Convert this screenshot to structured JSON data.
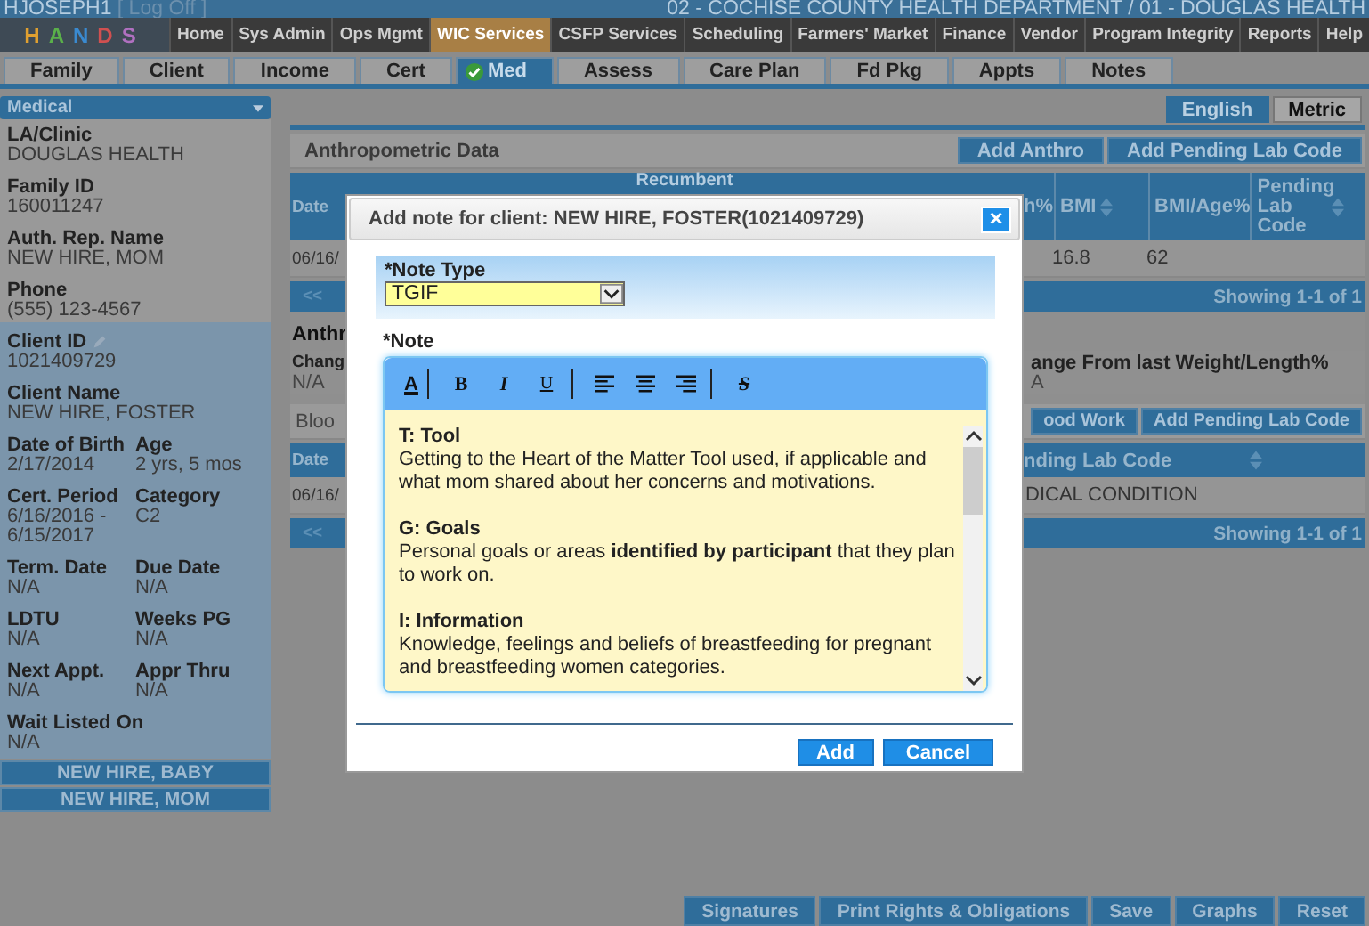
{
  "header": {
    "user": "HJOSEPH1",
    "logoff": "[ Log Off ]",
    "location": "02 - COCHISE COUNTY HEALTH DEPARTMENT / 01 - DOUGLAS HEALTH"
  },
  "logo": "HANDS",
  "menu": [
    {
      "label": "Home",
      "selected": false
    },
    {
      "label": "Sys Admin",
      "selected": false
    },
    {
      "label": "Ops Mgmt",
      "selected": false
    },
    {
      "label": "WIC Services",
      "selected": true
    },
    {
      "label": "CSFP Services",
      "selected": false
    },
    {
      "label": "Scheduling",
      "selected": false
    },
    {
      "label": "Farmers' Market",
      "selected": false
    },
    {
      "label": "Finance",
      "selected": false
    },
    {
      "label": "Vendor",
      "selected": false
    },
    {
      "label": "Program Integrity",
      "selected": false
    },
    {
      "label": "Reports",
      "selected": false
    },
    {
      "label": "Help",
      "selected": false
    }
  ],
  "tabs": [
    {
      "label": "Family",
      "selected": false,
      "checked": false
    },
    {
      "label": "Client",
      "selected": false,
      "checked": false
    },
    {
      "label": "Income",
      "selected": false,
      "checked": false
    },
    {
      "label": "Cert",
      "selected": false,
      "checked": false
    },
    {
      "label": "Med",
      "selected": true,
      "checked": true
    },
    {
      "label": "Assess",
      "selected": false,
      "checked": false
    },
    {
      "label": "Care Plan",
      "selected": false,
      "checked": false
    },
    {
      "label": "Fd Pkg",
      "selected": false,
      "checked": false
    },
    {
      "label": "Appts",
      "selected": false,
      "checked": false
    },
    {
      "label": "Notes",
      "selected": false,
      "checked": false
    }
  ],
  "sidebar": {
    "title": "Medical",
    "family_fields": [
      {
        "label": "LA/Clinic",
        "value": "DOUGLAS HEALTH"
      },
      {
        "label": "Family ID",
        "value": "160011247"
      },
      {
        "label": "Auth. Rep. Name",
        "value": "NEW HIRE, MOM"
      },
      {
        "label": "Phone",
        "value": "(555) 123-4567"
      }
    ],
    "client_fields": [
      {
        "kind": "full",
        "label": "Client ID",
        "value": "1021409729",
        "editable": true
      },
      {
        "kind": "full",
        "label": "Client Name",
        "value": "NEW HIRE, FOSTER",
        "editable": false
      },
      {
        "kind": "half",
        "label": "Date of Birth",
        "value": "2/17/2014",
        "editable": false
      },
      {
        "kind": "half",
        "label": "Age",
        "value": "2 yrs, 5 mos",
        "editable": false
      },
      {
        "kind": "half",
        "label": "Cert. Period",
        "value": "6/16/2016 - 6/15/2017",
        "editable": false
      },
      {
        "kind": "half",
        "label": "Category",
        "value": "C2",
        "editable": false
      },
      {
        "kind": "half",
        "label": "Term. Date",
        "value": "N/A",
        "editable": false
      },
      {
        "kind": "half",
        "label": "Due Date",
        "value": "N/A",
        "editable": false
      },
      {
        "kind": "half",
        "label": "LDTU",
        "value": "N/A",
        "editable": false
      },
      {
        "kind": "half",
        "label": "Weeks PG",
        "value": "N/A",
        "editable": false
      },
      {
        "kind": "half",
        "label": "Next Appt.",
        "value": "N/A",
        "editable": false
      },
      {
        "kind": "half",
        "label": "Appr Thru",
        "value": "N/A",
        "editable": false
      },
      {
        "kind": "full",
        "label": "Wait Listed On",
        "value": "N/A",
        "editable": false
      }
    ],
    "related_clients": [
      "NEW HIRE, BABY",
      "NEW HIRE, MOM"
    ]
  },
  "units": [
    {
      "label": "English",
      "selected": true
    },
    {
      "label": "Metric",
      "selected": false
    }
  ],
  "anthro": {
    "title": "Anthropometric Data",
    "buttons": [
      "Add Anthro",
      "Add Pending Lab Code"
    ],
    "left_header": "Date",
    "mid_header": "Recumbent",
    "columns": [
      {
        "header": "h%",
        "sortable": false
      },
      {
        "header": "BMI",
        "sortable": true,
        "value": "16.8"
      },
      {
        "header": "BMI/Age%",
        "sortable": false,
        "value": "62"
      },
      {
        "header": "Pending Lab Code",
        "sortable": true
      }
    ],
    "row_left": "06/16/",
    "pager": {
      "first": "<<",
      "summary": "Showing 1-1 of 1"
    }
  },
  "anthro_summary": {
    "heading": "Anthr",
    "left_label": "Chang",
    "left_value": "N/A",
    "right_label": "ange From last Weight/Length%",
    "right_value": "A"
  },
  "blood": {
    "title": "Bloo",
    "buttons": [
      "ood Work",
      "Add Pending Lab Code"
    ],
    "left_header": "Date",
    "right_header": "nding Lab Code",
    "row_left": "06/16/",
    "row_right": "DICAL CONDITION",
    "pager": {
      "first": "<<",
      "summary": "Showing 1-1 of 1"
    }
  },
  "modal": {
    "title": "Add note for client: NEW HIRE, FOSTER(1021409729)",
    "close": "×",
    "type_label": "*Note Type",
    "type_value": "TGIF",
    "note_label": "*Note",
    "toolbar": [
      [
        {
          "kind": "font-color",
          "label": "A"
        }
      ],
      [
        {
          "kind": "bold",
          "label": "B"
        },
        {
          "kind": "italic",
          "label": "I"
        },
        {
          "kind": "underline",
          "label": "U"
        }
      ],
      [
        {
          "kind": "align-left"
        },
        {
          "kind": "align-center"
        },
        {
          "kind": "align-right"
        }
      ],
      [
        {
          "kind": "strike",
          "label": "S"
        }
      ]
    ],
    "sections": [
      {
        "heading": "T: Tool",
        "text": "Getting to the Heart of the Matter Tool used, if applicable and what mom shared about her concerns and motivations."
      },
      {
        "heading": "G: Goals",
        "text": "Personal goals or areas **identified by participant** that they plan to work on."
      },
      {
        "heading": "I: Information",
        "text": "Knowledge, feelings and beliefs of breastfeeding for pregnant and breastfeeding women categories."
      }
    ],
    "buttons": [
      "Add",
      "Cancel"
    ]
  },
  "footer_buttons": [
    "Signatures",
    "Print Rights & Obligations",
    "Save",
    "Graphs",
    "Reset"
  ]
}
